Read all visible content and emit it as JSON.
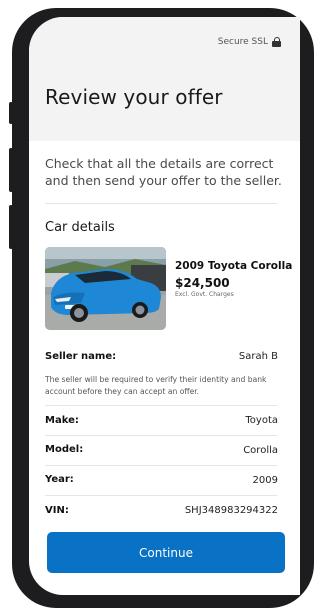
{
  "status": {
    "secure_label": "Secure SSL"
  },
  "page": {
    "title": "Review your offer",
    "intro": "Check that all the details are correct and then send your offer to the seller."
  },
  "car_details": {
    "section_title": "Car details",
    "name": "2009 Toyota Corolla",
    "price": "$24,500",
    "price_note": "Excl. Govt. Charges",
    "photo_icon": "car-photo"
  },
  "seller": {
    "label": "Seller name:",
    "value": "Sarah B",
    "note": "The seller will be required to verify their identity and bank account before they can accept an offer."
  },
  "specs": [
    {
      "label": "Make:",
      "value": "Toyota"
    },
    {
      "label": "Model:",
      "value": "Corolla"
    },
    {
      "label": "Year:",
      "value": "2009"
    },
    {
      "label": "VIN:",
      "value": "SHJ348983294322"
    }
  ],
  "actions": {
    "continue_label": "Continue"
  },
  "colors": {
    "accent": "#0a72c4",
    "header_bg": "#f3f3f3",
    "car_body": "#1e88d6"
  }
}
